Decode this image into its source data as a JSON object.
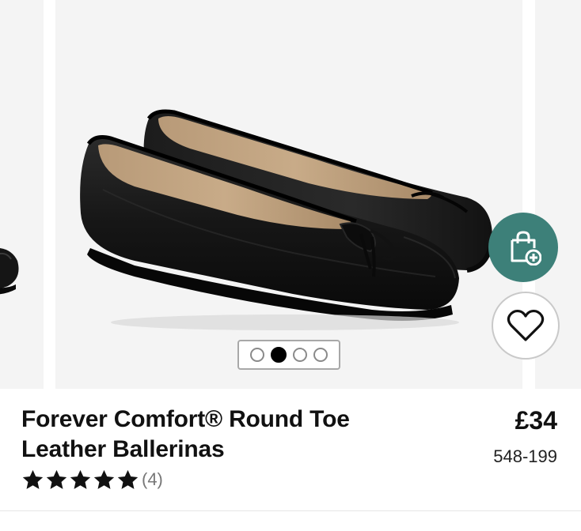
{
  "product": {
    "title_line1": "Forever Comfort® Round Toe",
    "title_line2": "Leather Ballerinas",
    "price": "£34",
    "item_code": "548-199",
    "rating": {
      "stars": 5,
      "max_stars": 5,
      "review_count": "(4)"
    }
  },
  "carousel": {
    "image_count": 4,
    "active_index": 1
  },
  "actions": {
    "bag_icon": "shopping-bag-plus-icon",
    "favourite_icon": "heart-icon"
  },
  "colors": {
    "accent": "#3d8079",
    "image_background": "#f4f4f4",
    "star": "#111111"
  }
}
